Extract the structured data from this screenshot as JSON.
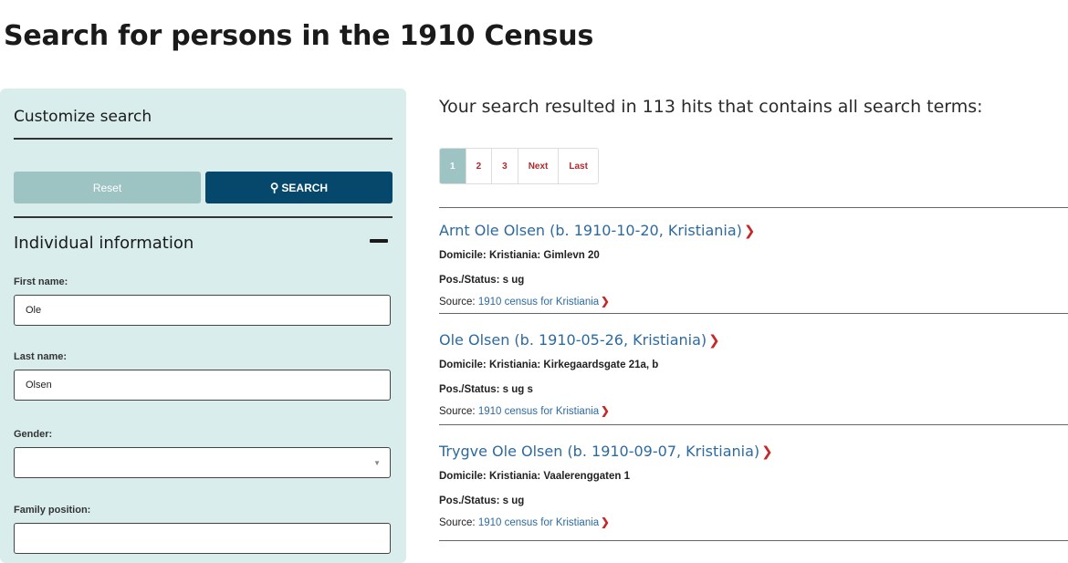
{
  "page_title": "Search for persons in the 1910 Census",
  "sidebar": {
    "customize_title": "Customize search",
    "reset_label": "Reset",
    "search_label": "SEARCH",
    "section_title": "Individual information",
    "fields": [
      {
        "label": "First name:",
        "value": "Ole"
      },
      {
        "label": "Last name:",
        "value": "Olsen"
      },
      {
        "label": "Gender:",
        "value": ""
      },
      {
        "label": "Family position:",
        "value": ""
      }
    ]
  },
  "results": {
    "summary": "Your search resulted in 113 hits that contains all search terms:",
    "pagination": [
      "1",
      "2",
      "3",
      "Next",
      "Last"
    ],
    "items": [
      {
        "name": "Arnt Ole Olsen (b. 1910-10-20, Kristiania)",
        "domicile": "Domicile: Kristiania: Gimlevn 20",
        "status": "Pos./Status: s ug",
        "source_prefix": "Source:",
        "source_link": "1910 census for Kristiania"
      },
      {
        "name": "Ole Olsen (b. 1910-05-26, Kristiania)",
        "domicile": "Domicile: Kristiania: Kirkegaardsgate 21a, b",
        "status": "Pos./Status: s ug s",
        "source_prefix": "Source:",
        "source_link": "1910 census for Kristiania"
      },
      {
        "name": "Trygve Ole Olsen (b. 1910-09-07, Kristiania)",
        "domicile": "Domicile: Kristiania: Vaalerenggaten 1",
        "status": "Pos./Status: s ug",
        "source_prefix": "Source:",
        "source_link": "1910 census for Kristiania"
      }
    ]
  },
  "colors": {
    "sidebar_bg": "#d9eded",
    "primary_button": "#05486b",
    "secondary_button": "#9dc3c3",
    "link": "#2d6aa0",
    "accent": "#c62828"
  },
  "icons": {
    "search": "search-icon",
    "collapse": "minus-icon",
    "chevron": "chevron-right-icon",
    "dropdown": "chevron-down-icon"
  }
}
